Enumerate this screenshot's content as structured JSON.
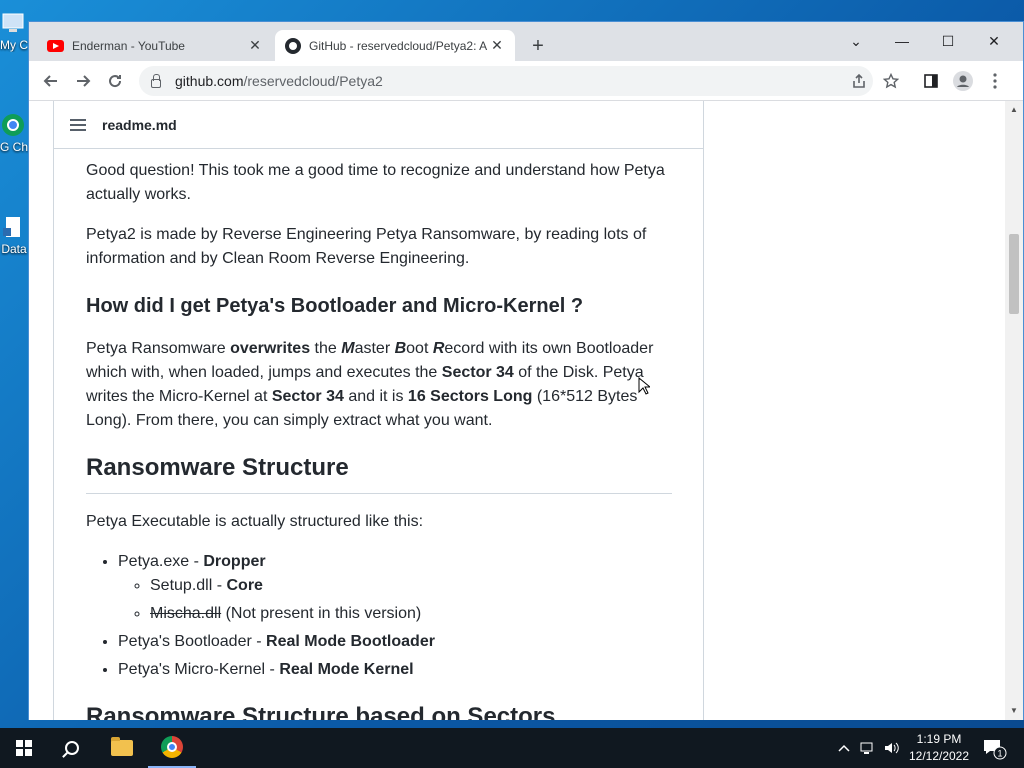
{
  "desktop": {
    "icons": [
      {
        "label": "My C",
        "name": "desktop-icon-my-computer"
      },
      {
        "label": "G Ch",
        "name": "desktop-icon-chrome"
      },
      {
        "label": "Data",
        "name": "desktop-icon-data"
      }
    ]
  },
  "browser": {
    "tabs": [
      {
        "title": "Enderman - YouTube",
        "favicon": "youtube-icon",
        "active": false
      },
      {
        "title": "GitHub - reservedcloud/Petya2: A",
        "favicon": "github-icon",
        "active": true
      }
    ],
    "new_tab": "+",
    "window_controls": {
      "list": "⌄",
      "minimize": "—",
      "maximize": "☐",
      "close": "✕"
    },
    "url_host": "github.com",
    "url_path": "/reservedcloud/Petya2"
  },
  "readme": {
    "filename": "readme.md",
    "p1": "Good question! This took me a good time to recognize and understand how Petya actually works.",
    "p2": "Petya2 is made by Reverse Engineering Petya Ransomware, by reading lots of information and by Clean Room Reverse Engineering.",
    "h3": "How did I get Petya's Bootloader and Micro-Kernel ?",
    "p3": {
      "t1": "Petya Ransomware ",
      "b1": "overwrites",
      "t2": " the ",
      "m": "M",
      "t3": "aster ",
      "bo": "B",
      "t4": "oot ",
      "r": "R",
      "t5": "ecord with its own Bootloader which with, when loaded, jumps and executes the ",
      "b2": "Sector 34",
      "t6": " of the Disk. Petya writes the Micro-Kernel at ",
      "b3": "Sector 34",
      "t7": " and it is ",
      "b4": "16 Sectors Long",
      "t8": " (16*512 Bytes Long). From there, you can simply extract what you want."
    },
    "h2": "Ransomware Structure",
    "p4": "Petya Executable is actually structured like this:",
    "list": {
      "i1": {
        "name": "Petya.exe - ",
        "role": "Dropper"
      },
      "i1a": {
        "name": "Setup.dll - ",
        "role": "Core"
      },
      "i1b": {
        "name": "Mischa.dll",
        "note": " (Not present in this version)"
      },
      "i2": {
        "name": "Petya's Bootloader - ",
        "role": "Real Mode Bootloader"
      },
      "i3": {
        "name": "Petya's Micro-Kernel - ",
        "role": "Real Mode Kernel"
      }
    },
    "next_heading": "Ransomware Structure based on Sectors"
  },
  "taskbar": {
    "time": "1:19 PM",
    "date": "12/12/2022",
    "notification_count": "1"
  }
}
